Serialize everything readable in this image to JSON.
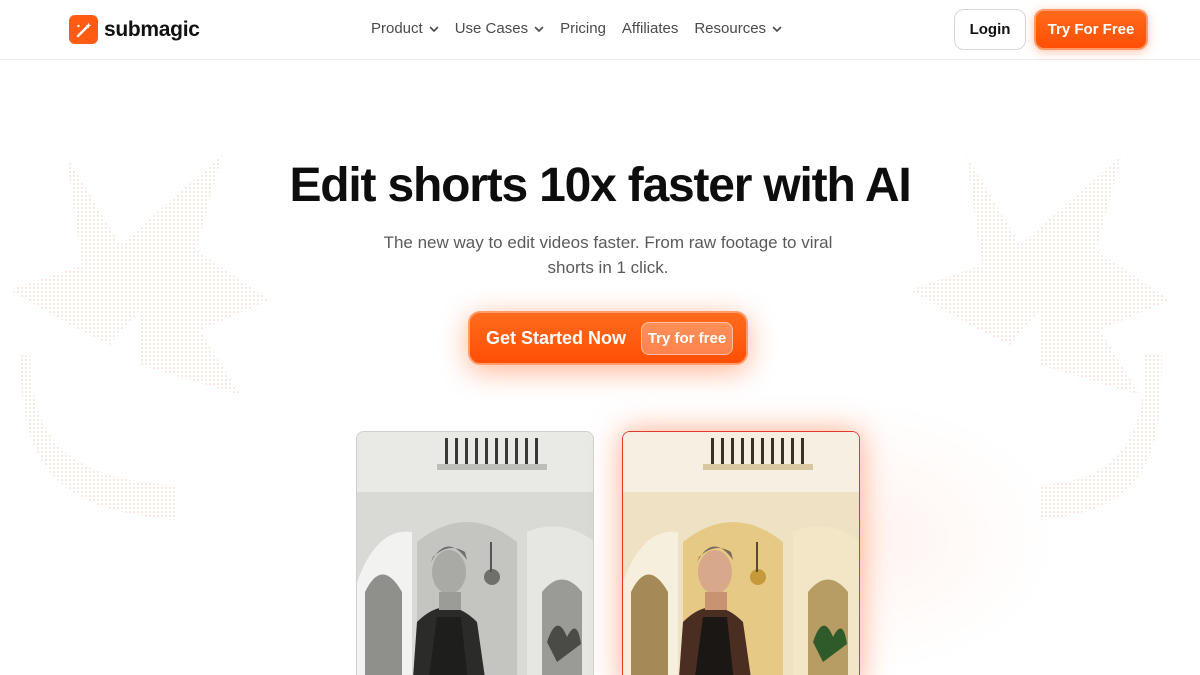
{
  "brand": {
    "name": "submagic",
    "accent": "#ff5b13"
  },
  "nav": {
    "items": [
      {
        "label": "Product",
        "has_dropdown": true
      },
      {
        "label": "Use Cases",
        "has_dropdown": true
      },
      {
        "label": "Pricing",
        "has_dropdown": false
      },
      {
        "label": "Affiliates",
        "has_dropdown": false
      },
      {
        "label": "Resources",
        "has_dropdown": true
      }
    ],
    "login_label": "Login",
    "try_label": "Try For Free"
  },
  "hero": {
    "title": "Edit shorts 10x faster with AI",
    "subtitle": "The new way to edit videos faster. From raw footage to viral shorts in 1 click.",
    "cta_label": "Get Started Now",
    "cta_pill": "Try for free"
  },
  "previews": [
    {
      "name": "video-before",
      "style": "grayscale"
    },
    {
      "name": "video-after",
      "style": "color-enhanced"
    }
  ]
}
